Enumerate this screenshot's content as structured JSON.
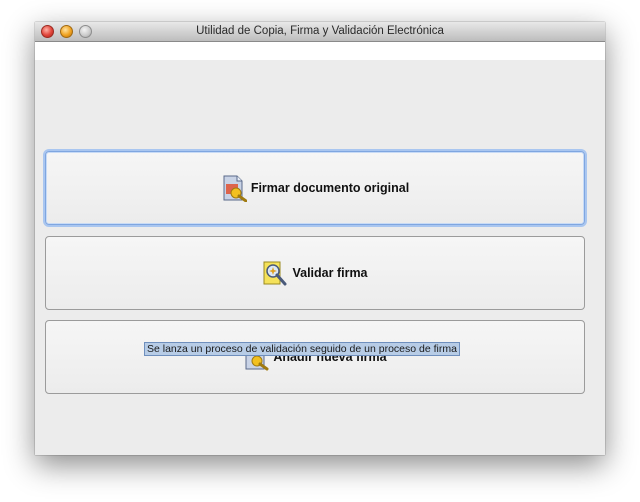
{
  "window": {
    "title": "Utilidad de Copia, Firma y Validación Electrónica"
  },
  "buttons": [
    {
      "label": "Firmar documento original",
      "icon": "sign-document-icon",
      "focused": true
    },
    {
      "label": "Validar firma",
      "icon": "validate-signature-icon",
      "focused": false
    },
    {
      "label": "Añadir nueva firma",
      "icon": "add-signature-icon",
      "focused": false
    }
  ],
  "tooltip": {
    "text": "Se lanza un proceso de validación seguido de un proceso de firma"
  }
}
